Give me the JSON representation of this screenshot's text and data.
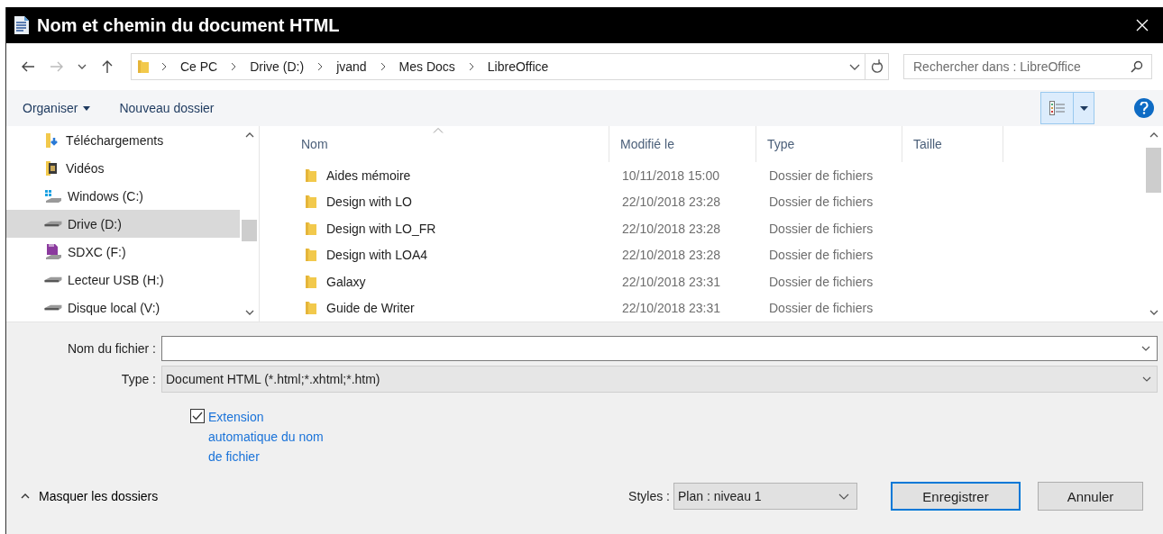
{
  "window": {
    "title": "Nom et chemin du document HTML"
  },
  "address_bar": {
    "breadcrumb": [
      "Ce PC",
      "Drive (D:)",
      "jvand",
      "Mes Docs",
      "LibreOffice"
    ]
  },
  "search": {
    "placeholder": "Rechercher dans : LibreOffice"
  },
  "toolbar": {
    "organize": "Organiser",
    "new_folder": "Nouveau dossier"
  },
  "sidebar": {
    "items": [
      {
        "label": "Téléchargements",
        "kind": "downloads",
        "selected": false
      },
      {
        "label": "Vidéos",
        "kind": "videos",
        "selected": false
      },
      {
        "label": "Windows (C:)",
        "kind": "system-drive",
        "selected": false
      },
      {
        "label": "Drive (D:)",
        "kind": "drive",
        "selected": true
      },
      {
        "label": "SDXC (F:)",
        "kind": "sd-card",
        "selected": false
      },
      {
        "label": "Lecteur USB (H:)",
        "kind": "drive",
        "selected": false
      },
      {
        "label": "Disque local (V:)",
        "kind": "drive",
        "selected": false
      }
    ]
  },
  "table": {
    "columns": [
      "Nom",
      "Modifié le",
      "Type",
      "Taille"
    ],
    "rows": [
      {
        "name": "Aides mémoire",
        "modified": "10/11/2018 15:00",
        "type": "Dossier de fichiers"
      },
      {
        "name": "Design with LO",
        "modified": "22/10/2018 23:28",
        "type": "Dossier de fichiers"
      },
      {
        "name": "Design with LO_FR",
        "modified": "22/10/2018 23:28",
        "type": "Dossier de fichiers"
      },
      {
        "name": "Design with LOA4",
        "modified": "22/10/2018 23:28",
        "type": "Dossier de fichiers"
      },
      {
        "name": "Galaxy",
        "modified": "22/10/2018 23:31",
        "type": "Dossier de fichiers"
      },
      {
        "name": "Guide de Writer",
        "modified": "22/10/2018 23:31",
        "type": "Dossier de fichiers"
      }
    ]
  },
  "form": {
    "filename_label": "Nom du fichier :",
    "type_label": "Type :",
    "type_value": "Document HTML (*.html;*.xhtml;*.htm)",
    "auto_extension": {
      "label": "Extension automatique du nom de fichier",
      "checked": true
    }
  },
  "footer": {
    "hide_folders": "Masquer les dossiers",
    "styles_label": "Styles :",
    "styles_value": "Plan : niveau 1",
    "buttons": [
      {
        "label": "Enregistrer",
        "default": true
      },
      {
        "label": "Annuler",
        "default": false
      }
    ]
  }
}
